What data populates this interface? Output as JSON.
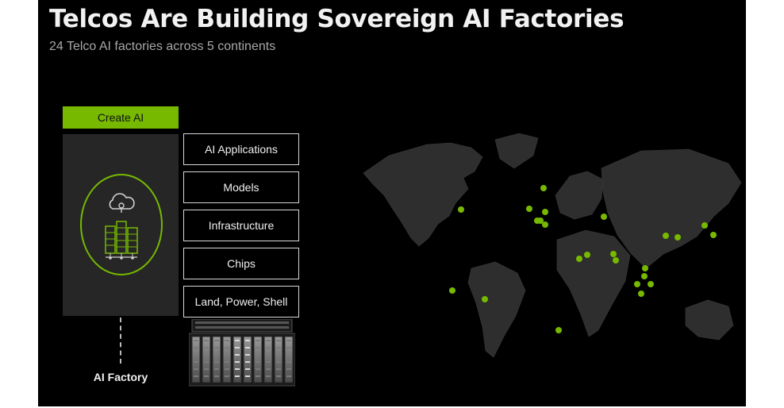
{
  "slide": {
    "title": "Telcos Are Building Sovereign AI Factories",
    "subtitle": "24 Telco AI factories across 5 continents"
  },
  "create_ai": {
    "label": "Create AI"
  },
  "stack_layers": [
    "AI Applications",
    "Models",
    "Infrastructure",
    "Chips",
    "Land, Power, Shell"
  ],
  "ai_factory": {
    "label": "AI Factory"
  },
  "colors": {
    "accent": "#76b900",
    "background": "#000000",
    "land": "#2e2e2e",
    "panel": "#262626"
  },
  "icons": [
    "cloud-icon",
    "server-rack-icon",
    "data-center-rack-icon",
    "world-map-icon",
    "location-dot-icon"
  ],
  "map": {
    "factory_count": 24
  }
}
